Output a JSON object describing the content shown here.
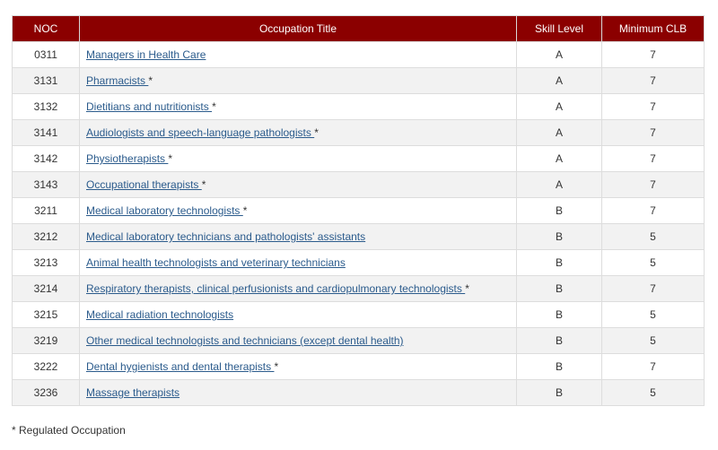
{
  "table": {
    "headers": {
      "noc": "NOC",
      "title": "Occupation Title",
      "skill": "Skill Level",
      "clb": "Minimum CLB"
    },
    "rows": [
      {
        "noc": "0311",
        "title": "Managers in Health Care",
        "regulated": "",
        "skill": "A",
        "clb": "7"
      },
      {
        "noc": "3131",
        "title": "Pharmacists ",
        "regulated": "*",
        "skill": "A",
        "clb": "7"
      },
      {
        "noc": "3132",
        "title": "Dietitians and nutritionists ",
        "regulated": "*",
        "skill": "A",
        "clb": "7"
      },
      {
        "noc": "3141",
        "title": "Audiologists and speech-language pathologists ",
        "regulated": "*",
        "skill": "A",
        "clb": "7"
      },
      {
        "noc": "3142",
        "title": "Physiotherapists ",
        "regulated": "*",
        "skill": "A",
        "clb": "7"
      },
      {
        "noc": "3143",
        "title": "Occupational therapists ",
        "regulated": "*",
        "skill": "A",
        "clb": "7"
      },
      {
        "noc": "3211",
        "title": "Medical laboratory technologists ",
        "regulated": "*",
        "skill": "B",
        "clb": "7"
      },
      {
        "noc": "3212",
        "title": "Medical laboratory technicians and pathologists' assistants",
        "regulated": "",
        "skill": "B",
        "clb": "5"
      },
      {
        "noc": "3213",
        "title": "Animal health technologists and veterinary technicians",
        "regulated": "",
        "skill": "B",
        "clb": "5"
      },
      {
        "noc": "3214",
        "title": "Respiratory therapists, clinical perfusionists and cardiopulmonary technologists ",
        "regulated": "*",
        "skill": "B",
        "clb": "7"
      },
      {
        "noc": "3215",
        "title": "Medical radiation technologists",
        "regulated": "",
        "skill": "B",
        "clb": "5"
      },
      {
        "noc": "3219",
        "title": "Other medical technologists and technicians (except dental health)",
        "regulated": "",
        "skill": "B",
        "clb": "5"
      },
      {
        "noc": "3222",
        "title": "Dental hygienists and dental therapists ",
        "regulated": "*",
        "skill": "B",
        "clb": "7"
      },
      {
        "noc": "3236",
        "title": "Massage therapists",
        "regulated": "",
        "skill": "B",
        "clb": "5"
      }
    ]
  },
  "footnote": "* Regulated Occupation",
  "colors": {
    "header_bg": "#8b0000",
    "link": "#2b5b8c",
    "stripe": "#f2f2f2"
  }
}
